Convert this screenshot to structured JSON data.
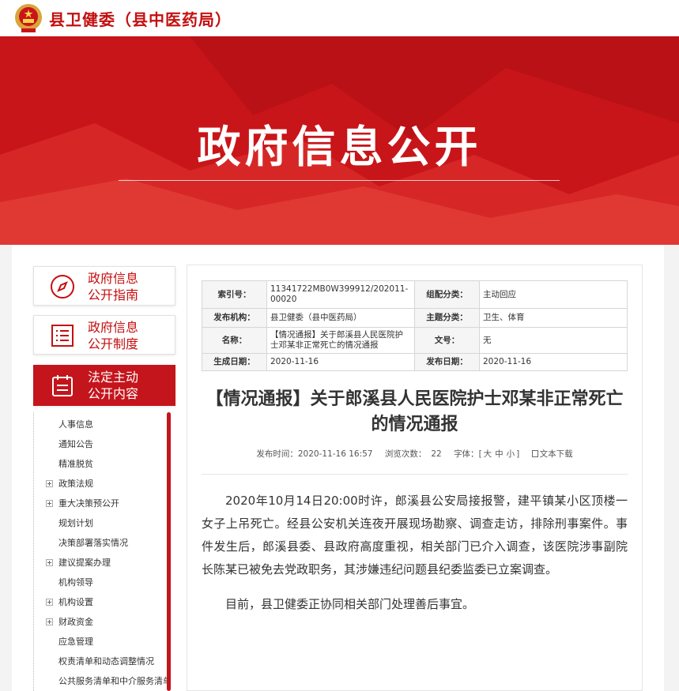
{
  "header": {
    "site_title": "县卫健委（县中医药局）",
    "banner_title": "政府信息公开"
  },
  "sidebar": {
    "cards": [
      {
        "line1": "政府信息",
        "line2": "公开指南",
        "icon": "compass-icon"
      },
      {
        "line1": "政府信息",
        "line2": "公开制度",
        "icon": "list-icon"
      },
      {
        "line1": "法定主动",
        "line2": "公开内容",
        "icon": "calendar-icon"
      }
    ],
    "tree": [
      {
        "label": "人事信息",
        "expandable": false
      },
      {
        "label": "通知公告",
        "expandable": false
      },
      {
        "label": "精准脱贫",
        "expandable": false
      },
      {
        "label": "政策法规",
        "expandable": true
      },
      {
        "label": "重大决策预公开",
        "expandable": true
      },
      {
        "label": "规划计划",
        "expandable": false
      },
      {
        "label": "决策部署落实情况",
        "expandable": false
      },
      {
        "label": "建议提案办理",
        "expandable": true
      },
      {
        "label": "机构领导",
        "expandable": false
      },
      {
        "label": "机构设置",
        "expandable": true
      },
      {
        "label": "财政资金",
        "expandable": true
      },
      {
        "label": "应急管理",
        "expandable": false
      },
      {
        "label": "权责清单和动态调整情况",
        "expandable": false
      },
      {
        "label": "公共服务清单和中介服务清单",
        "expandable": false
      }
    ]
  },
  "meta": {
    "index_label": "索引号：",
    "index_value": "11341722MB0W399912/202011-00020",
    "category_label": "组配分类：",
    "category_value": "主动回应",
    "publisher_label": "发布机构：",
    "publisher_value": "县卫健委（县中医药局）",
    "subject_label": "主题分类：",
    "subject_value": "卫生、体育",
    "name_label": "名称：",
    "name_value": "【情况通报】关于郎溪县人民医院护士邓某非正常死亡的情况通报",
    "docno_label": "文号：",
    "docno_value": "无",
    "created_label": "生成日期：",
    "created_value": "2020-11-16",
    "pubdate_label": "发布日期：",
    "pubdate_value": "2020-11-16"
  },
  "article": {
    "title": "【情况通报】关于郎溪县人民医院护士邓某非正常死亡的情况通报",
    "publish_time": "发布时间：2020-11-16 16:57",
    "views_label": "浏览次数：",
    "views": "22",
    "font_label": "字体：",
    "font_open": "[",
    "font_large": "大",
    "font_medium": "中",
    "font_small": "小",
    "font_close": "]",
    "download_label": "文本下载",
    "paragraphs": [
      "2020年10月14日20:00时许，郎溪县公安局接报警，建平镇某小区顶楼一女子上吊死亡。经县公安机关连夜开展现场勘察、调查走访，排除刑事案件。事件发生后，郎溪县委、县政府高度重视，相关部门已介入调查，该医院涉事副院长陈某已被免去党政职务，其涉嫌违纪问题县纪委监委已立案调查。",
      "目前，县卫健委正协同相关部门处理善后事宜。"
    ]
  },
  "colors": {
    "brand_red": "#c40f0f",
    "banner_red": "#d21c20",
    "menu_active": "#c4151c"
  }
}
